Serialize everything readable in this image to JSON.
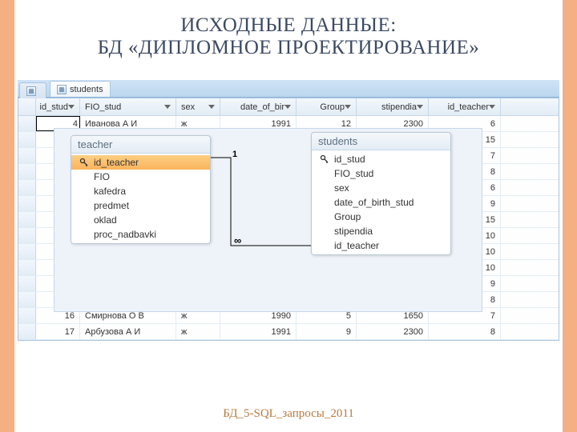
{
  "title": {
    "line1": "ИСХОДНЫЕ ДАННЫЕ:",
    "line2": "БД «ДИПЛОМНОЕ ПРОЕКТИРОВАНИЕ»"
  },
  "footer": "БД_5-SQL_запросы_2011",
  "tabs": [
    {
      "label": "students"
    }
  ],
  "datasheet": {
    "columns": [
      {
        "key": "id_stud",
        "label": "id_stud"
      },
      {
        "key": "FIO_stud",
        "label": "FIO_stud"
      },
      {
        "key": "sex",
        "label": "sex"
      },
      {
        "key": "date_of_bir",
        "label": "date_of_bir"
      },
      {
        "key": "Group",
        "label": "Group"
      },
      {
        "key": "stipendia",
        "label": "stipendia"
      },
      {
        "key": "id_teacher",
        "label": "id_teacher"
      }
    ],
    "topRow": {
      "id_stud": "4",
      "FIO_stud": "Иванова А И",
      "sex": "ж",
      "date_of_bir": "1991",
      "Group": "12",
      "stipendia": "2300",
      "id_teacher": "6"
    },
    "partialTeacherCol": [
      "15",
      "7",
      "8",
      "6",
      "9",
      "15",
      "10",
      "10",
      "10",
      "9",
      "8"
    ],
    "bottomRows": [
      {
        "id_stud": "16",
        "FIO_stud": "Смирнова О В",
        "sex": "ж",
        "date_of_bir": "1990",
        "Group": "5",
        "stipendia": "1650",
        "id_teacher": "7"
      },
      {
        "id_stud": "17",
        "FIO_stud": "Арбузова А И",
        "sex": "ж",
        "date_of_bir": "1991",
        "Group": "9",
        "stipendia": "2300",
        "id_teacher": "8"
      }
    ]
  },
  "relationship": {
    "teacher": {
      "title": "teacher",
      "fields": [
        "id_teacher",
        "FIO",
        "kafedra",
        "predmet",
        "oklad",
        "proc_nadbavki"
      ]
    },
    "students": {
      "title": "students",
      "fields": [
        "id_stud",
        "FIO_stud",
        "sex",
        "date_of_birth_stud",
        "Group",
        "stipendia",
        "id_teacher"
      ]
    },
    "labelOne": "1",
    "labelMany": "∞"
  }
}
